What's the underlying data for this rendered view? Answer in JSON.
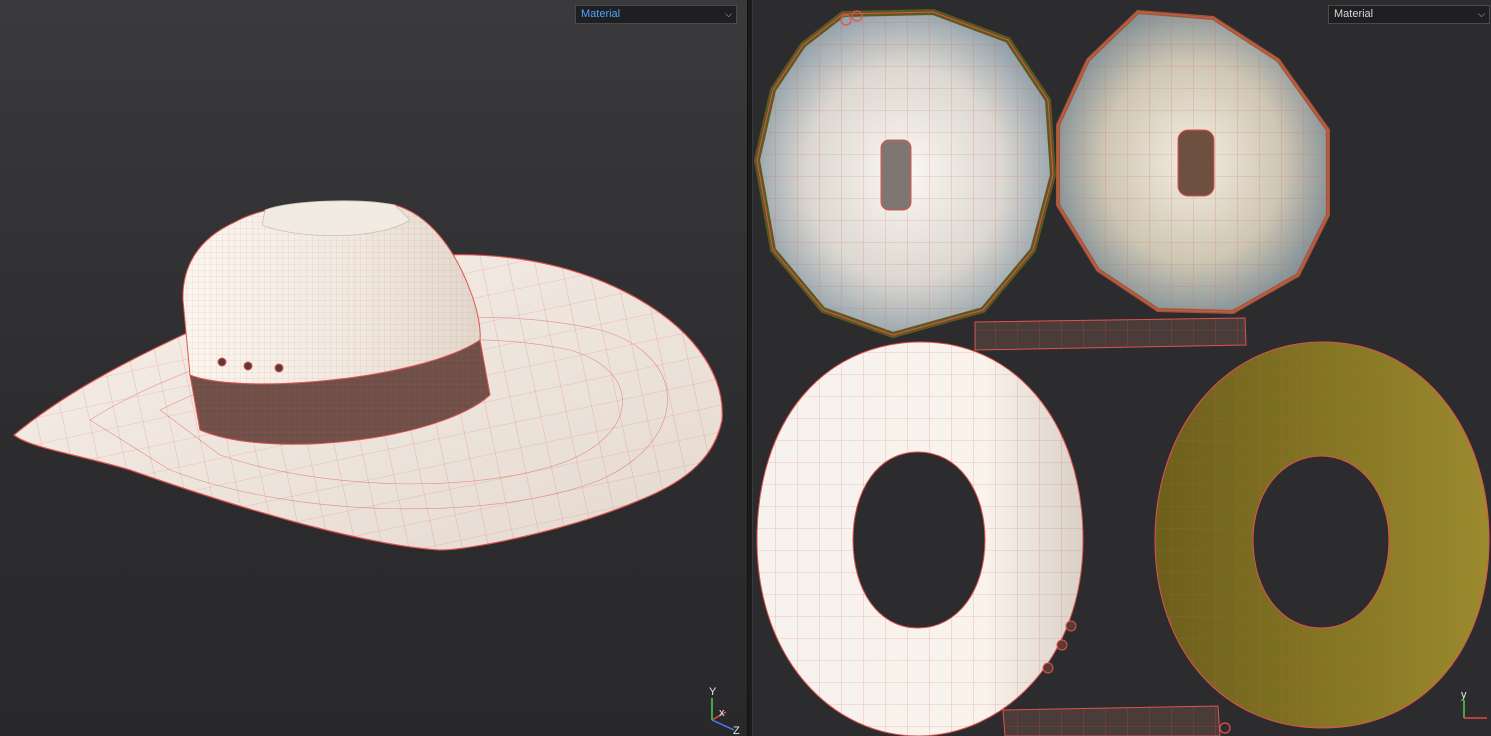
{
  "viewport_3d": {
    "material_dropdown": {
      "value": "Material",
      "accent_color": "#4da3ff"
    },
    "axis_gizmo": {
      "y_label": "Y",
      "x_label": "x",
      "z_label": "Z"
    }
  },
  "viewport_uv": {
    "material_dropdown": {
      "value": "Material"
    },
    "axis_gizmo": {
      "y_label": "y"
    }
  },
  "colors": {
    "wireframe": "#e0524f",
    "hat_surface": "#f4ece4",
    "hat_band": "#6e5048",
    "selected_island_tint": "#7d6a1e"
  }
}
